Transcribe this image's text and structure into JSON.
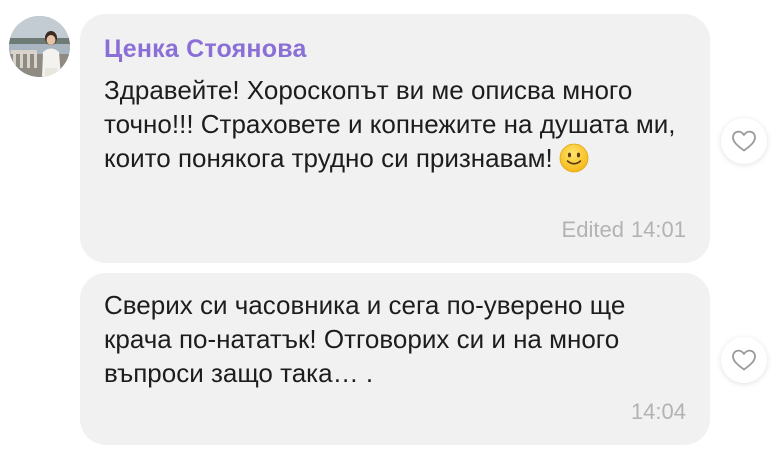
{
  "colors": {
    "sender_name": "#8a6fd6",
    "bubble_bg": "#f1f1f1",
    "text": "#1d1d1f",
    "meta": "#b3b3b3",
    "heart_outline": "#9a9a9a"
  },
  "messages": [
    {
      "sender": "Ценка Стоянова",
      "text": "Здравейте! Хороскопът ви ме описва много точно!!! Страховете и копнежите на душата ми, които понякога трудно си признавам!",
      "emoji": "slightly-smiling-face-icon",
      "edited_label": "Edited",
      "time": "14:01",
      "like_icon": "heart-outline-icon"
    },
    {
      "text": "Сверих си часовника и сега по-уверено ще крача по-нататък! Отговорих си и на много въпроси защо така… .",
      "time": "14:04",
      "like_icon": "heart-outline-icon"
    }
  ],
  "avatar_icon": "user-avatar-photo"
}
